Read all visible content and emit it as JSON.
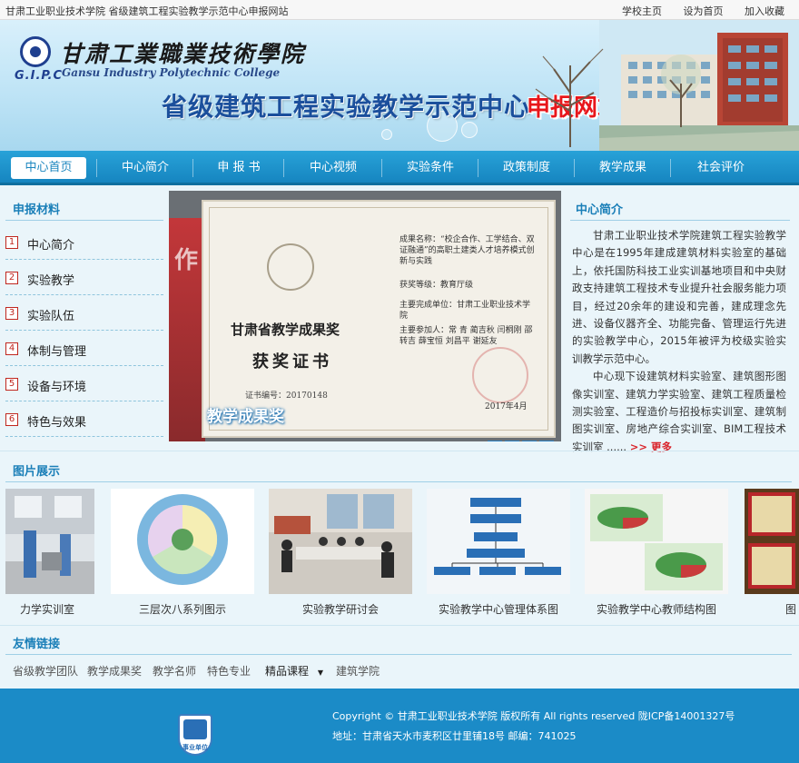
{
  "topbar": {
    "site_title": "甘肃工业职业技术学院 省级建筑工程实验教学示范中心申报网站",
    "links": [
      "学校主页",
      "设为首页",
      "加入收藏"
    ]
  },
  "banner": {
    "school_name_cn": "甘肃工業職業技術學院",
    "school_abbr": "G.I.P.C",
    "school_name_en": "Gansu Industry Polytechnic College",
    "title": "省级建筑工程实验教学示范中心",
    "subtitle": "申报网站"
  },
  "nav": {
    "items": [
      "中心首页",
      "中心简介",
      "申 报 书",
      "中心视频",
      "实验条件",
      "政策制度",
      "教学成果",
      "社会评价"
    ],
    "active": "中心首页"
  },
  "materials": {
    "title": "申报材料",
    "items": [
      {
        "num": "1",
        "label": "中心简介"
      },
      {
        "num": "2",
        "label": "实验教学"
      },
      {
        "num": "3",
        "label": "实验队伍"
      },
      {
        "num": "4",
        "label": "体制与管理"
      },
      {
        "num": "5",
        "label": "设备与环境"
      },
      {
        "num": "6",
        "label": "特色与效果"
      }
    ]
  },
  "feature": {
    "caption": "教学成果奖",
    "certificate": {
      "title1": "甘肃省教学成果奖",
      "title2": "获奖证书",
      "number": "证书编号：20170148",
      "result_name": "成果名称：“校企合作、工学结合、双证融通”的高职土建类人才培养模式创新与实践",
      "award_level": "获奖等级：教育厅级",
      "unit": "主要完成单位：甘肃工业职业技术学院",
      "participants": "主要参加人：常 青 蔺吉秋 闫桐刚 邵转吉 薛宝恒 刘昌平 谢延友",
      "date": "2017年4月"
    }
  },
  "intro": {
    "title": "中心简介",
    "para1": "甘肃工业职业技术学院建筑工程实验教学中心是在1995年建成建筑材料实验室的基础上，依托国防科技工业实训基地项目和中央财政支持建筑工程技术专业提升社会服务能力项目，经过20余年的建设和完善，建成理念先进、设备仪器齐全、功能完备、管理运行先进的实验教学中心，2015年被评为校级实验实训教学示范中心。",
    "para2": "中心现下设建筑材料实验室、建筑图形图像实训室、建筑力学实验室、建筑工程质量检测实验室、工程造价与招投标实训室、建筑制图实训室、房地产综合实训室、BIM工程技术实训室 ......",
    "more": ">> 更多"
  },
  "gallery": {
    "title": "图片展示",
    "captions": [
      "力学实训室",
      "三层次八系列图示",
      "实验教学研讨会",
      "实验教学中心管理体系图",
      "实验教学中心教师结构图",
      "图"
    ]
  },
  "friend_links": {
    "title": "友情链接",
    "items": [
      "省级教学团队",
      "教学成果奖",
      "教学名师",
      "特色专业",
      "精品课程",
      "建筑学院"
    ],
    "dropdown_item": "精品课程"
  },
  "footer": {
    "copyright": "Copyright © 甘肃工业职业技术学院 版权所有 All rights reserved 陇ICP备14001327号",
    "address": "地址：甘肃省天水市麦积区廿里铺18号     邮编：741025",
    "badge": "事业单位"
  },
  "colors": {
    "nav_blue": "#1b8bc7",
    "title_blue": "#1a7fb8",
    "accent_red": "#d9232a"
  }
}
